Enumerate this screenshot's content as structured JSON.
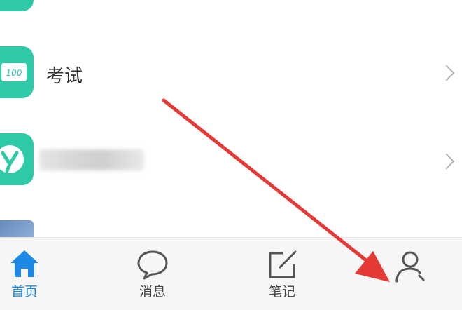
{
  "list": {
    "items": [
      {
        "label": "考试",
        "icon": "exam-100-icon"
      },
      {
        "label": "",
        "icon": "y-logo-icon",
        "blurred": true
      }
    ]
  },
  "tabbar": {
    "tabs": [
      {
        "label": "首页",
        "icon": "home-icon",
        "active": true
      },
      {
        "label": "消息",
        "icon": "chat-bubble-icon"
      },
      {
        "label": "笔记",
        "icon": "note-edit-icon"
      },
      {
        "label": "",
        "icon": "person-icon"
      }
    ]
  },
  "colors": {
    "accent": "#1e88e5",
    "item_icon": "#2ec9a7",
    "annotation_arrow": "#e53935"
  }
}
